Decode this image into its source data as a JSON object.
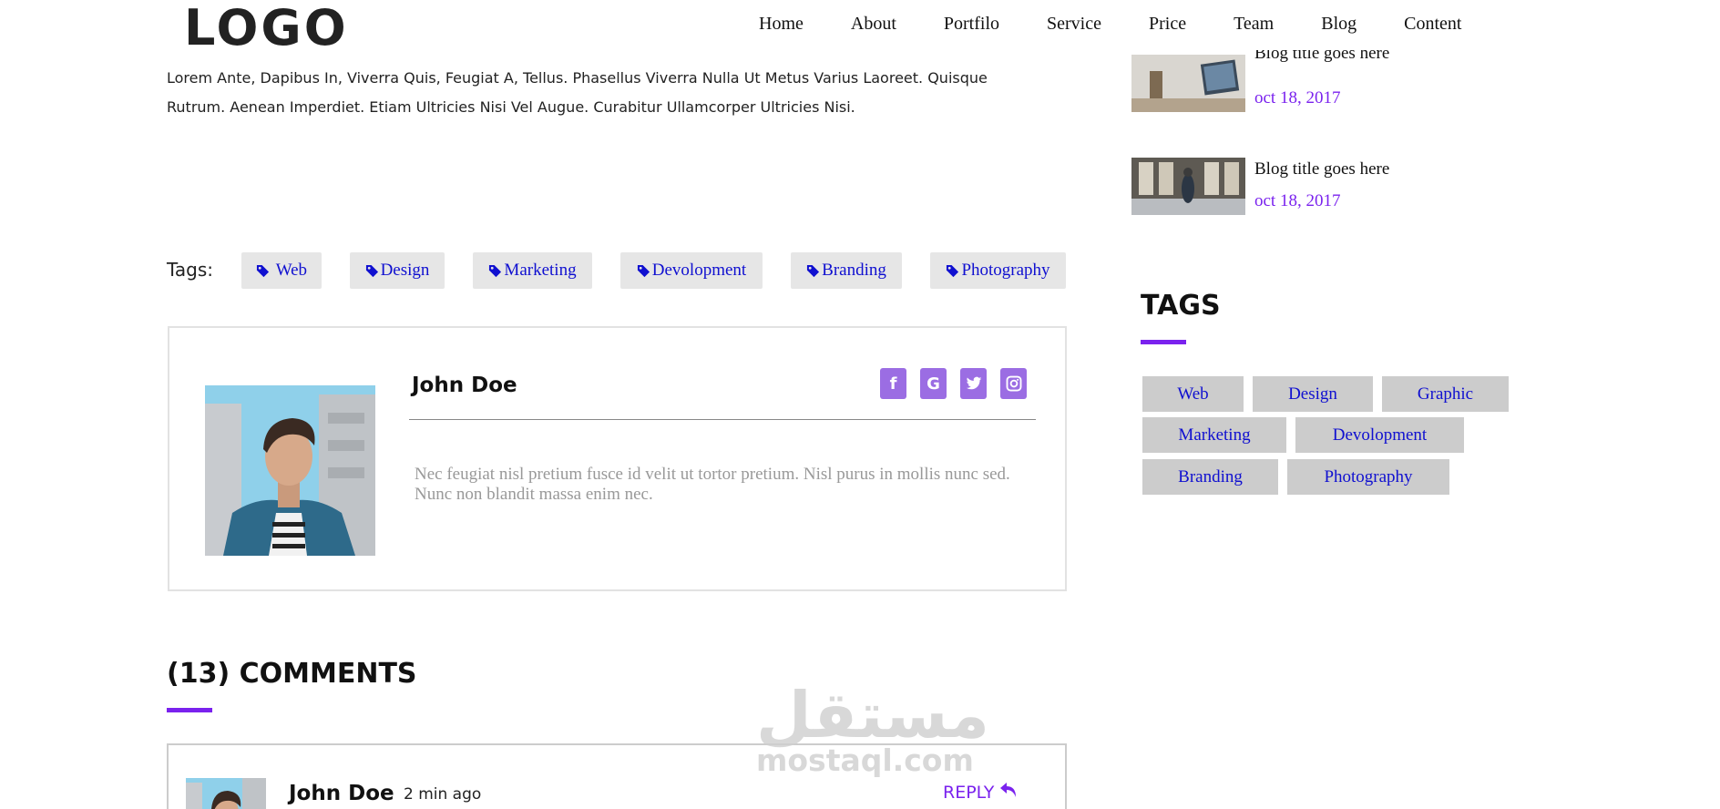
{
  "header": {
    "logo": "LOGO",
    "nav": [
      "Home",
      "About",
      "Portfilo",
      "Service",
      "Price",
      "Team",
      "Blog",
      "Content"
    ]
  },
  "article": {
    "intro_line1": "Lorem Ante, Dapibus In, Viverra Quis, Feugiat A, Tellus. Phasellus Viverra Nulla Ut Metus Varius Laoreet. Quisque",
    "intro_line2": "Rutrum. Aenean Imperdiet. Etiam Ultricies Nisi Vel Augue. Curabitur Ullamcorper Ultricies Nisi.",
    "tags_label": "Tags:",
    "tags": [
      "Web",
      "Design",
      "Marketing",
      "Devolopment",
      "Branding",
      "Photography"
    ]
  },
  "author": {
    "name": "John Doe",
    "bio": "Nec feugiat nisl pretium fusce id velit ut tortor pretium. Nisl purus in mollis nunc sed. Nunc non blandit massa enim nec.",
    "socials": [
      {
        "icon": "facebook-icon",
        "glyph": "f"
      },
      {
        "icon": "google-icon",
        "glyph": "G"
      },
      {
        "icon": "twitter-icon",
        "glyph": ""
      },
      {
        "icon": "instagram-icon",
        "glyph": ""
      }
    ]
  },
  "comments": {
    "title": "(13) COMMENTS",
    "items": [
      {
        "name": "John Doe",
        "time": "2 min ago",
        "reply_label": "REPLY"
      }
    ]
  },
  "sidebar": {
    "posts": [
      {
        "title": "Blog title goes here",
        "date": "oct 18, 2017"
      },
      {
        "title": "Blog title goes here",
        "date": "oct 18, 2017"
      }
    ],
    "tags_title": "TAGS",
    "tags": [
      "Web",
      "Design",
      "Graphic",
      "Marketing",
      "Devolopment",
      "Branding",
      "Photography"
    ]
  },
  "watermark": {
    "arabic": "مستقل",
    "latin": "mostaql.com"
  },
  "colors": {
    "accent": "#7a22ee",
    "tag_text": "#1010d0",
    "social_bg": "#9b6de3",
    "tag_bg": "#e6e6e6",
    "sidebar_tag_bg": "#cccccc"
  }
}
